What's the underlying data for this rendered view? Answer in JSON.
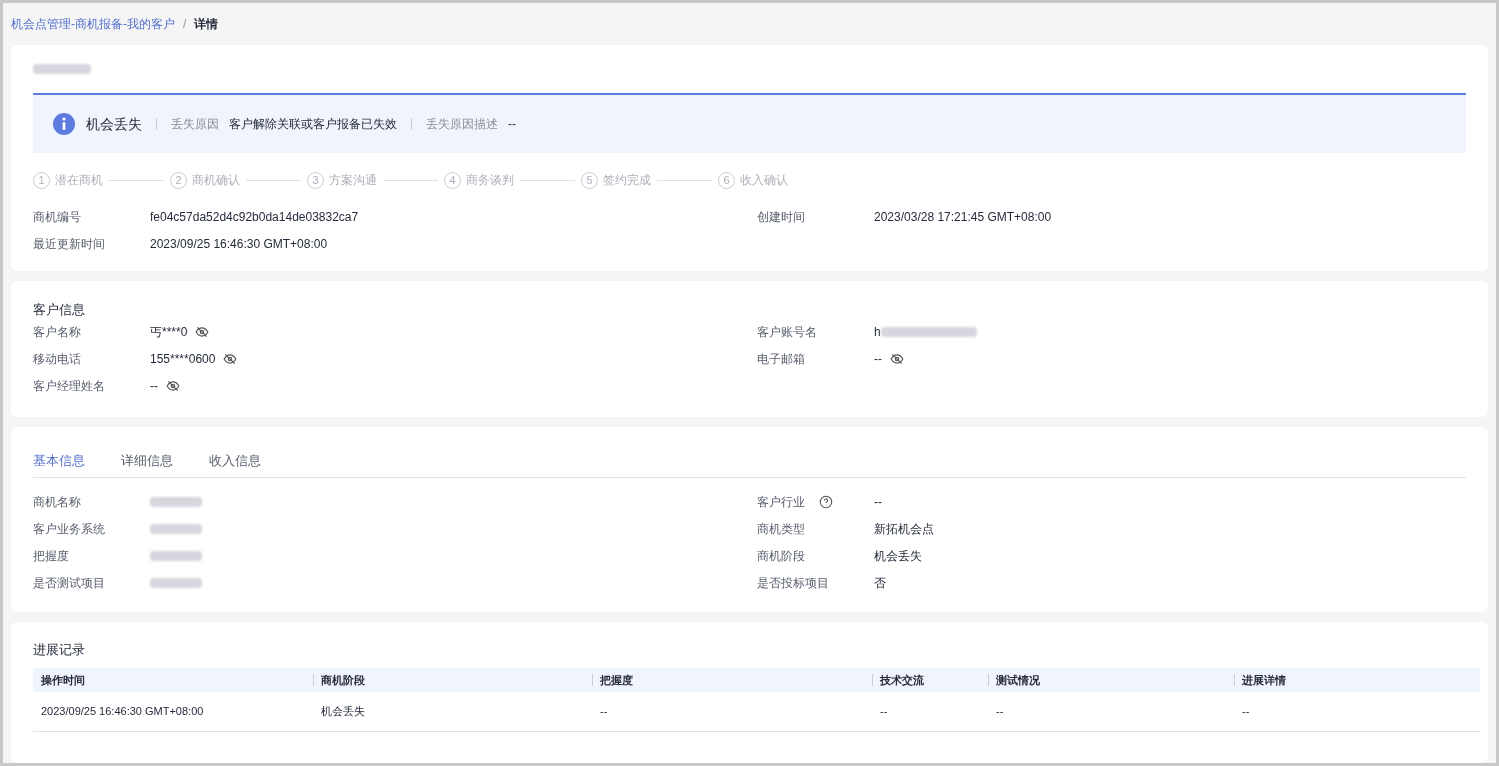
{
  "breadcrumb": {
    "items": [
      {
        "label": "机会点管理-商机报备-我的客户",
        "kind": "link"
      },
      {
        "label": "详情",
        "kind": "current"
      }
    ],
    "separator": "/"
  },
  "header": {
    "title_redacted": true,
    "alert": {
      "status": "机会丢失",
      "fields": [
        {
          "label": "丢失原因",
          "value": "客户解除关联或客户报备已失效"
        },
        {
          "label": "丢失原因描述",
          "value": "--"
        }
      ]
    },
    "steps": [
      {
        "number": "1",
        "label": "潜在商机"
      },
      {
        "number": "2",
        "label": "商机确认"
      },
      {
        "number": "3",
        "label": "方案沟通"
      },
      {
        "number": "4",
        "label": "商务谈判"
      },
      {
        "number": "5",
        "label": "签约完成"
      },
      {
        "number": "6",
        "label": "收入确认"
      }
    ],
    "left_fields": [
      {
        "label": "商机编号",
        "value": "fe04c57da52d4c92b0da14de03832ca7"
      },
      {
        "label": "最近更新时间",
        "value": "2023/09/25 16:46:30 GMT+08:00"
      }
    ],
    "right_fields": [
      {
        "label": "创建时间",
        "value": "2023/03/28 17:21:45 GMT+08:00"
      }
    ]
  },
  "customer": {
    "title": "客户信息",
    "left_fields": [
      {
        "label": "客户名称",
        "value": "丐****0",
        "masked": true
      },
      {
        "label": "移动电话",
        "value": "155****0600",
        "masked": true
      },
      {
        "label": "客户经理姓名",
        "value": "--",
        "masked": true
      }
    ],
    "right_fields": [
      {
        "label": "客户账号名",
        "value": "h",
        "redacted": true,
        "masked": false
      },
      {
        "label": "电子邮箱",
        "value": "--",
        "masked": true
      }
    ]
  },
  "basic": {
    "tabs": [
      {
        "label": "基本信息",
        "selected": true
      },
      {
        "label": "详细信息",
        "selected": false
      },
      {
        "label": "收入信息",
        "selected": false
      }
    ],
    "left_fields": [
      {
        "label": "商机名称",
        "redacted": true
      },
      {
        "label": "客户业务系统",
        "redacted": true
      },
      {
        "label": "把握度",
        "redacted": true
      },
      {
        "label": "是否测试项目",
        "redacted": true
      }
    ],
    "right_fields": [
      {
        "label": "客户行业",
        "value": "--",
        "help": true
      },
      {
        "label": "商机类型",
        "value": "新拓机会点"
      },
      {
        "label": "商机阶段",
        "value": "机会丢失"
      },
      {
        "label": "是否投标项目",
        "value": "否"
      }
    ]
  },
  "progress": {
    "title": "进展记录",
    "table": {
      "columns": [
        "操作时间",
        "商机阶段",
        "把握度",
        "技术交流",
        "测试情况",
        "进展详情"
      ],
      "rows": [
        [
          "2023/09/25 16:46:30 GMT+08:00",
          "机会丢失",
          "--",
          "--",
          "--",
          "--"
        ]
      ]
    }
  }
}
